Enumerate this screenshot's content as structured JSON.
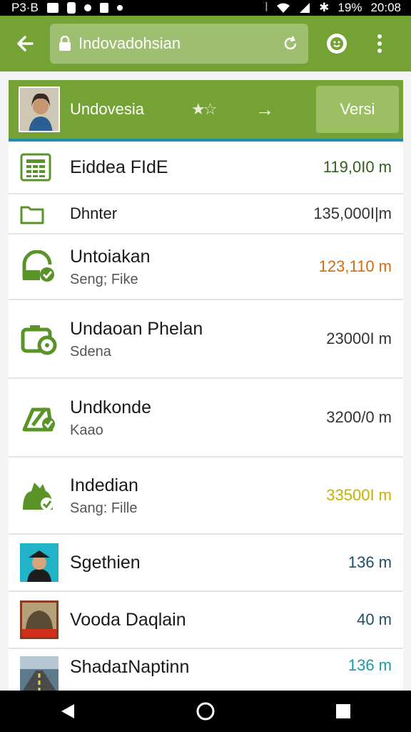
{
  "status_bar": {
    "left_text": "P3·B",
    "right_battery": "19%",
    "right_time": "20:08"
  },
  "app_bar": {
    "url_text": "Indovadohsian"
  },
  "header_card": {
    "title": "Undovesia",
    "stars": "★☆",
    "arrow": "→",
    "button_label": "Versi"
  },
  "files": [
    {
      "name": "Eiddea FIdE",
      "sub": "",
      "size": "119,0I0 m",
      "size_color": "#2f5f1b",
      "icon": "spreadsheet-icon"
    },
    {
      "name": "Dhnter",
      "sub": "",
      "size": "135,000I|m",
      "size_color": "#333333",
      "icon": "folder-icon"
    },
    {
      "name": "Untoiakan",
      "sub": "Seng; Fike",
      "size": "123,110 m",
      "size_color": "#d46a12",
      "icon": "download-check-icon"
    },
    {
      "name": "Undaoan Phelan",
      "sub": "Sdena",
      "size": "23000I m",
      "size_color": "#333333",
      "icon": "camera-icon"
    },
    {
      "name": "Undkonde",
      "sub": "Kaao",
      "size": "3200/0 m",
      "size_color": "#333333",
      "icon": "edit-check-icon"
    },
    {
      "name": "Indedian",
      "sub": "Sang: Fille",
      "size": "33500I m",
      "size_color": "#c9b000",
      "icon": "bag-check-icon"
    },
    {
      "name": "Sgethien",
      "sub": "",
      "size": "136 m",
      "size_color": "#1c4f6a",
      "icon": "avatar-thumbnail"
    },
    {
      "name": "Vooda Daqlain",
      "sub": "",
      "size": "40 m",
      "size_color": "#1c4f6a",
      "icon": "album-thumbnail"
    },
    {
      "name": "ShadaɪNaptinn",
      "sub": "",
      "size": "136 m",
      "size_color": "#1a9aa8",
      "icon": "road-thumbnail"
    }
  ],
  "colors": {
    "primary": "#74a234",
    "accent": "#1f8fa6"
  }
}
